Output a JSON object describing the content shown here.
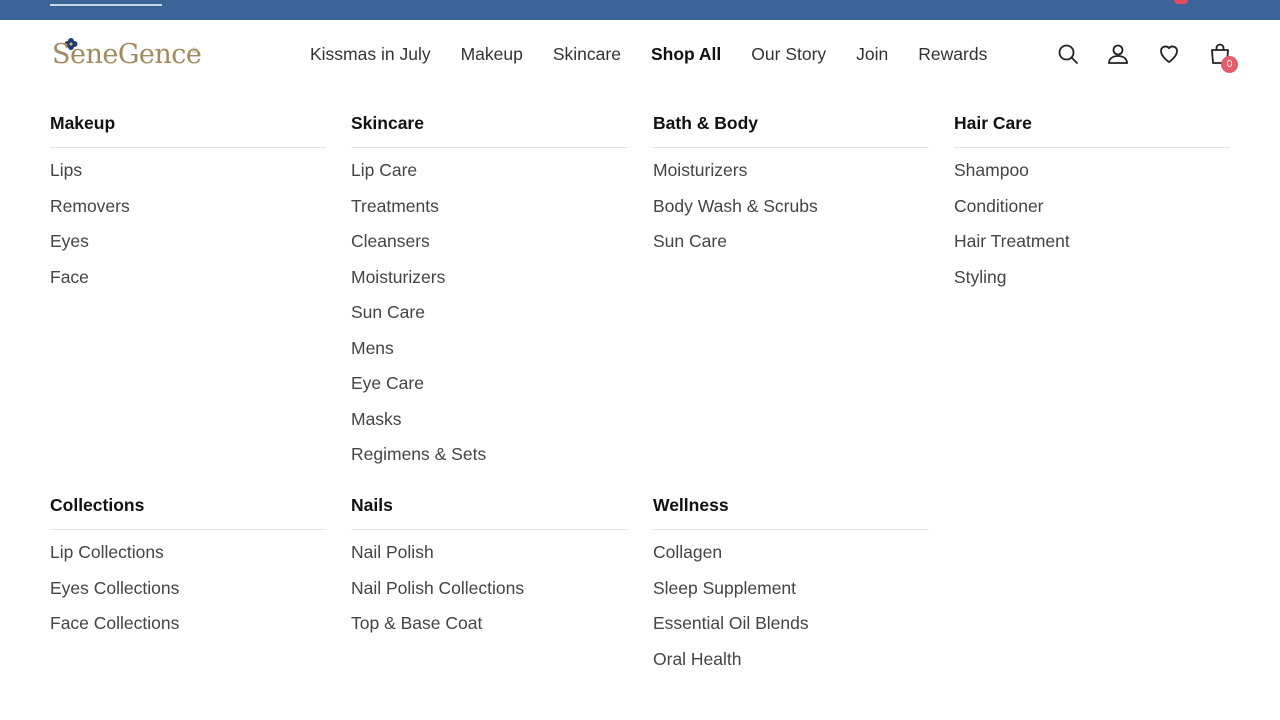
{
  "header": {
    "logo_text": "SeneGence",
    "logo_reg": "®",
    "nav": [
      "Kissmas in July",
      "Makeup",
      "Skincare",
      "Shop All",
      "Our Story",
      "Join",
      "Rewards"
    ],
    "active_nav": "Shop All",
    "icons": [
      "search-icon",
      "account-icon",
      "heart-icon",
      "cart-icon"
    ],
    "cart_count": "0"
  },
  "colors": {
    "topbar": "#3d6499",
    "logo": "#a08a5f",
    "badge": "#e35d6a"
  },
  "menu": {
    "row1": [
      {
        "title": "Makeup",
        "items": [
          "Lips",
          "Removers",
          "Eyes",
          "Face"
        ]
      },
      {
        "title": "Skincare",
        "items": [
          "Lip Care",
          "Treatments",
          "Cleansers",
          "Moisturizers",
          "Sun Care",
          "Mens",
          "Eye Care",
          "Masks",
          "Regimens & Sets"
        ]
      },
      {
        "title": "Bath & Body",
        "items": [
          "Moisturizers",
          "Body Wash & Scrubs",
          "Sun Care"
        ]
      },
      {
        "title": "Hair Care",
        "items": [
          "Shampoo",
          "Conditioner",
          "Hair Treatment",
          "Styling"
        ]
      }
    ],
    "row2": [
      {
        "title": "Collections",
        "items": [
          "Lip Collections",
          "Eyes Collections",
          "Face Collections"
        ]
      },
      {
        "title": "Nails",
        "items": [
          "Nail Polish",
          "Nail Polish Collections",
          "Top & Base Coat"
        ]
      },
      {
        "title": "Wellness",
        "items": [
          "Collagen",
          "Sleep Supplement",
          "Essential Oil Blends",
          "Oral Health"
        ]
      }
    ]
  }
}
